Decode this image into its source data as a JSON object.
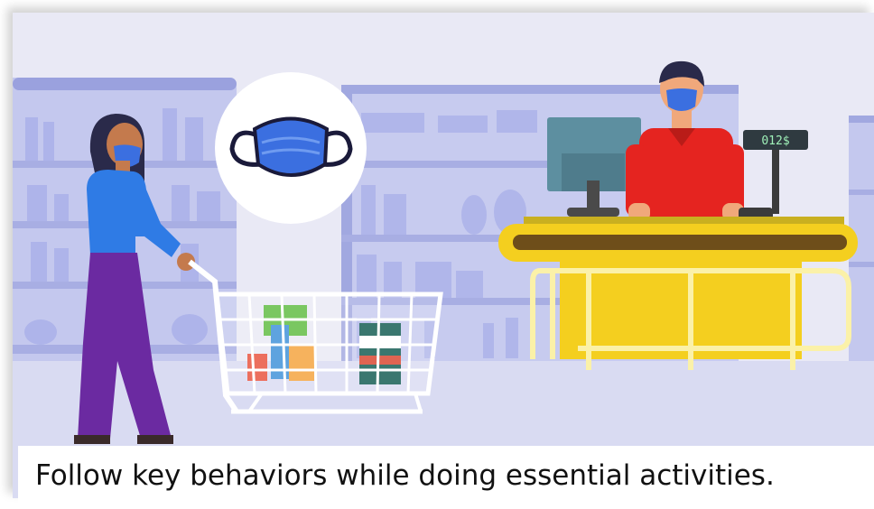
{
  "caption": "Follow key behaviors while doing essential activities.",
  "register_display": "012$",
  "colors": {
    "background": "#e9e9f5",
    "shelf": "#b8bde8",
    "shelf_dark": "#9aa1de",
    "counter": "#f4cf1f",
    "counter_dark": "#7a5a1a",
    "mask": "#3b6fe0",
    "cashier_shirt": "#e52420",
    "shopper_top": "#2f7be5",
    "shopper_pants": "#6b2aa1"
  },
  "icons": [
    "face-mask-icon",
    "shopping-cart-icon",
    "cash-register-icon",
    "computer-monitor-icon"
  ]
}
